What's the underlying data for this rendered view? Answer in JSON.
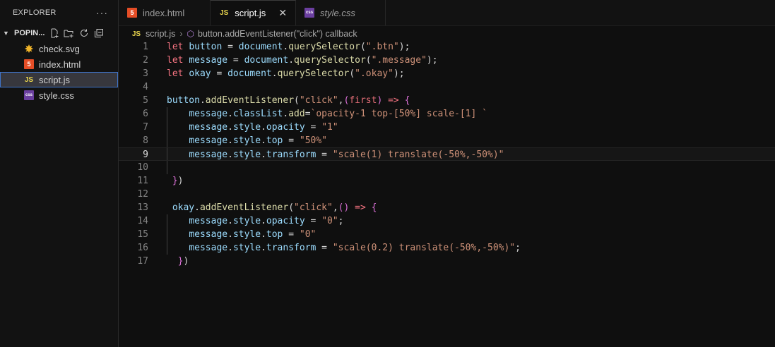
{
  "sidebar": {
    "header": "EXPLORER",
    "more": "···",
    "folder": "POPIN...",
    "files": [
      {
        "name": "check.svg",
        "icon": "svg-file-icon",
        "badge": "SVG"
      },
      {
        "name": "index.html",
        "icon": "html-file-icon",
        "badge": "5"
      },
      {
        "name": "script.js",
        "icon": "js-file-icon",
        "badge": "JS"
      },
      {
        "name": "style.css",
        "icon": "css-file-icon",
        "badge": "css"
      }
    ]
  },
  "tabs": [
    {
      "label": "index.html",
      "badge": "5"
    },
    {
      "label": "script.js",
      "badge": "JS",
      "close": "✕"
    },
    {
      "label": "style.css",
      "badge": "css"
    }
  ],
  "breadcrumb": {
    "badge": "JS",
    "file": "script.js",
    "symbol": "button.addEventListener(\"click\") callback"
  },
  "editor": {
    "line_numbers": [
      "1",
      "2",
      "3",
      "4",
      "5",
      "6",
      "7",
      "8",
      "9",
      "10",
      "11",
      "12",
      "13",
      "14",
      "15",
      "16",
      "17"
    ],
    "current_line": 9
  },
  "colors": {
    "background": "#0f0f0f",
    "sidebar": "#121212",
    "keyword": "#c586c0",
    "string": "#ce9178",
    "variable": "#9cdcfe",
    "function": "#dcdcaa",
    "active_border": "#3f74c9"
  }
}
